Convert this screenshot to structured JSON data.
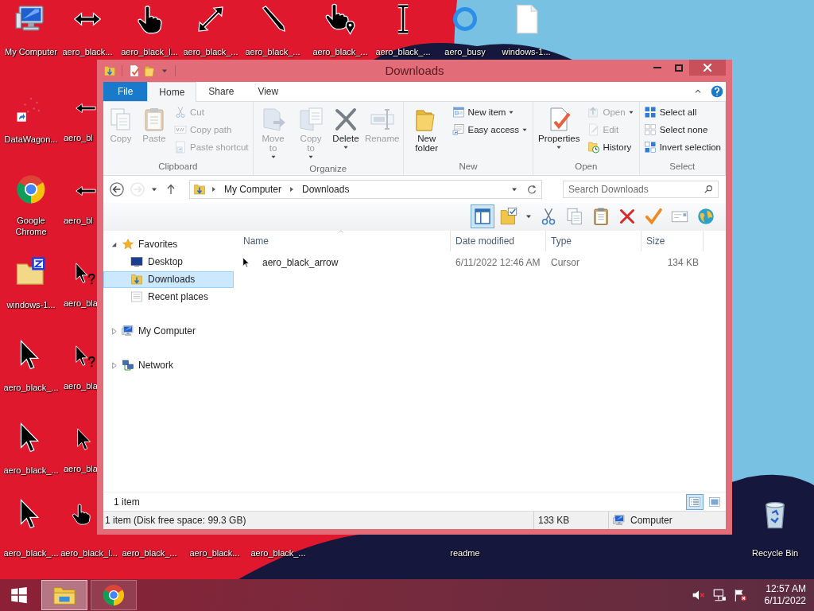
{
  "desktop": {
    "icons": [
      {
        "label": "My Computer"
      },
      {
        "label": "aero_black..."
      },
      {
        "label": "aero_black_l..."
      },
      {
        "label": "aero_black_..."
      },
      {
        "label": "aero_black_..."
      },
      {
        "label": "aero_black_..."
      },
      {
        "label": "aero_black_..."
      },
      {
        "label": "aero_busy"
      },
      {
        "label": "windows-1..."
      },
      {
        "label": "DataWagon..."
      },
      {
        "label": "aero_bl"
      },
      {
        "label": "Google Chrome"
      },
      {
        "label": "aero_bl"
      },
      {
        "label": "windows-1..."
      },
      {
        "label": "aero_bla"
      },
      {
        "label": "aero_black_..."
      },
      {
        "label": "aero_bla"
      },
      {
        "label": "aero_black_..."
      },
      {
        "label": "aero_bla"
      },
      {
        "label": "aero_black_..."
      },
      {
        "label": "aero_black_l..."
      },
      {
        "label": "aero_black_..."
      },
      {
        "label": "aero_black..."
      },
      {
        "label": "aero_black_..."
      },
      {
        "label": "readme"
      },
      {
        "label": "Recycle Bin"
      }
    ]
  },
  "window": {
    "title": "Downloads",
    "ribbon": {
      "tabs": [
        {
          "label": "File",
          "kind": "menu",
          "selected": false
        },
        {
          "label": "Home",
          "kind": "tab",
          "selected": true
        },
        {
          "label": "Share",
          "kind": "tab",
          "selected": false
        },
        {
          "label": "View",
          "kind": "tab",
          "selected": false
        }
      ],
      "groups": [
        {
          "label": "Clipboard",
          "buttons": [
            {
              "label": "Copy",
              "kind": "large",
              "disabled": true,
              "dropdown": false
            },
            {
              "label": "Paste",
              "kind": "large",
              "disabled": true,
              "dropdown": false
            },
            {
              "label": "Cut",
              "kind": "small",
              "disabled": true,
              "dropdown": false
            },
            {
              "label": "Copy path",
              "kind": "small",
              "disabled": true,
              "dropdown": false
            },
            {
              "label": "Paste shortcut",
              "kind": "small",
              "disabled": true,
              "dropdown": false
            }
          ]
        },
        {
          "label": "Organize",
          "buttons": [
            {
              "label": "Move to",
              "kind": "large",
              "disabled": true,
              "dropdown": true
            },
            {
              "label": "Copy to",
              "kind": "large",
              "disabled": true,
              "dropdown": true
            },
            {
              "label": "Delete",
              "kind": "large",
              "disabled": false,
              "dropdown": true
            },
            {
              "label": "Rename",
              "kind": "large",
              "disabled": true,
              "dropdown": false
            }
          ]
        },
        {
          "label": "New",
          "buttons": [
            {
              "label": "New folder",
              "kind": "large",
              "disabled": false,
              "dropdown": false
            },
            {
              "label": "New item",
              "kind": "small",
              "disabled": false,
              "dropdown": true
            },
            {
              "label": "Easy access",
              "kind": "small",
              "disabled": false,
              "dropdown": true
            }
          ]
        },
        {
          "label": "Open",
          "buttons": [
            {
              "label": "Properties",
              "kind": "large",
              "disabled": false,
              "dropdown": true
            },
            {
              "label": "Open",
              "kind": "small",
              "disabled": true,
              "dropdown": true
            },
            {
              "label": "Edit",
              "kind": "small",
              "disabled": true,
              "dropdown": false
            },
            {
              "label": "History",
              "kind": "small",
              "disabled": false,
              "dropdown": false
            }
          ]
        },
        {
          "label": "Select",
          "buttons": [
            {
              "label": "Select all",
              "kind": "small",
              "disabled": false,
              "dropdown": false
            },
            {
              "label": "Select none",
              "kind": "small",
              "disabled": false,
              "dropdown": false
            },
            {
              "label": "Invert selection",
              "kind": "small",
              "disabled": false,
              "dropdown": false
            }
          ]
        }
      ]
    },
    "navigation": {
      "back_disabled": false,
      "forward_disabled": true
    },
    "address": {
      "path": [
        "My Computer",
        "Downloads"
      ],
      "search_placeholder": "Search Downloads"
    },
    "toolbar": [
      {
        "selected": true
      },
      {
        "selected": false
      },
      {
        "selected": false
      },
      {
        "selected": false
      },
      {
        "selected": false
      },
      {
        "selected": false
      },
      {
        "selected": false
      },
      {
        "selected": false
      },
      {
        "selected": false
      },
      {
        "selected": false
      }
    ],
    "nav_tree": [
      {
        "label": "Favorites",
        "expanded": true,
        "selected": false,
        "children": [
          {
            "label": "Desktop",
            "selected": false
          },
          {
            "label": "Downloads",
            "selected": true
          },
          {
            "label": "Recent places",
            "selected": false
          }
        ]
      },
      {
        "label": "My Computer",
        "expanded": false,
        "selected": false
      },
      {
        "label": "Network",
        "expanded": false,
        "selected": false
      }
    ],
    "file_list": {
      "columns": [
        "Name",
        "Date modified",
        "Type",
        "Size"
      ],
      "rows": [
        {
          "name": "aero_black_arrow",
          "date_modified": "6/11/2022 12:46 AM",
          "type": "Cursor",
          "size": "134 KB",
          "selected": false
        }
      ]
    },
    "item_count": "1 item",
    "view_buttons": [
      {
        "selected": true
      },
      {
        "selected": false
      }
    ],
    "status_bar": [
      "1 item (Disk free space: 99.3 GB)",
      "133 KB",
      "Computer"
    ]
  },
  "taskbar": {
    "apps": [
      {
        "active": true
      },
      {
        "active": false
      }
    ],
    "clock": {
      "time": "12:57 AM",
      "date": "6/11/2022"
    }
  }
}
